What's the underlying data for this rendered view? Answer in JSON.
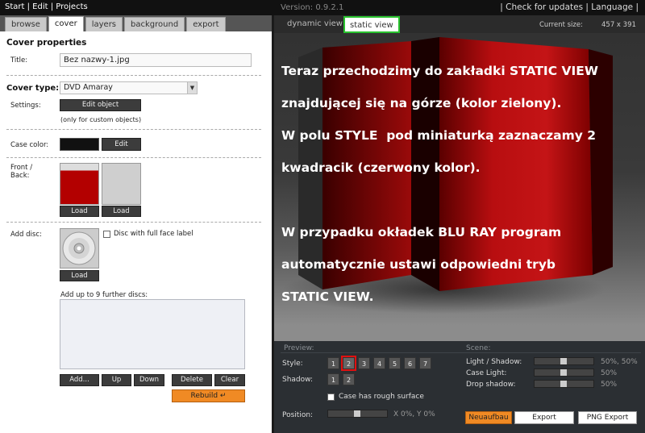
{
  "menu": {
    "start": "Start",
    "sep1": " | ",
    "edit": "Edit",
    "sep2": " | ",
    "projects": "Projects"
  },
  "version": "Version: 0.9.2.1",
  "topright": {
    "sep0": "| ",
    "check_updates": "Check for updates",
    "sep1": " | ",
    "language": "Language",
    "sep2": " |"
  },
  "left_tabs": [
    {
      "label": "browse",
      "active": false
    },
    {
      "label": "cover",
      "active": true
    },
    {
      "label": "layers",
      "active": false
    },
    {
      "label": "background",
      "active": false
    },
    {
      "label": "export",
      "active": false
    }
  ],
  "cover_properties": {
    "heading": "Cover properties",
    "title_label": "Title:",
    "title_value": "Bez nazwy-1.jpg",
    "cover_type_label": "Cover type:",
    "cover_type_value": "DVD Amaray",
    "settings_label": "Settings:",
    "edit_object": "Edit object",
    "custom_note": "(only for custom objects)",
    "case_color_label": "Case color:",
    "case_color": "#111111",
    "edit": "Edit",
    "front_back_label": "Front /\nBack:",
    "front_color": "#b30000",
    "load_front": "Load",
    "load_back": "Load",
    "add_disc_label": "Add disc:",
    "disc_full_face": "Disc with full face label",
    "load_disc": "Load",
    "further_discs": "Add up to 9 further discs:",
    "add": "Add...",
    "up": "Up",
    "down": "Down",
    "delete": "Delete",
    "clear": "Clear",
    "rebuild": "Rebuild",
    "rebuild_arrow": "↵"
  },
  "view_tabs": {
    "dynamic": "dynamic view",
    "static": "static view",
    "current_size_label": "Current size:",
    "current_size_value": "457 x 391"
  },
  "overlay": {
    "para1_l1": "Teraz przechodzimy do zakładki STATIC VIEW",
    "para1_l2": "znajdującej się na górze (kolor zielony).",
    "para1_l3": "W polu STYLE  pod miniaturką zaznaczamy 2",
    "para1_l4": "kwadracik (czerwony kolor).",
    "para2_l1": "W przypadku okładek BLU RAY program",
    "para2_l2": "automatycznie ustawi odpowiedni tryb",
    "para2_l3": "STATIC VIEW."
  },
  "preview": {
    "heading": "Preview:",
    "style_label": "Style:",
    "style_options": [
      "1",
      "2",
      "3",
      "4",
      "5",
      "6",
      "7"
    ],
    "style_selected": "2",
    "shadow_label": "Shadow:",
    "shadow_options": [
      "1",
      "2"
    ],
    "rough_surface": "Case has rough surface",
    "position_label": "Position:",
    "position_value": "X 0%, Y 0%"
  },
  "scene": {
    "heading": "Scene:",
    "light_shadow_label": "Light / Shadow:",
    "light_shadow_value": "50%, 50%",
    "case_light_label": "Case Light:",
    "case_light_value": "50%",
    "drop_shadow_label": "Drop shadow:",
    "drop_shadow_value": "50%"
  },
  "actions": {
    "neuaufbau": "Neuaufbau",
    "export": "Export",
    "png_export": "PNG Export"
  },
  "colors": {
    "accent_orange": "#f08a24",
    "highlight_green": "#29c22e",
    "highlight_red": "#e01010"
  }
}
